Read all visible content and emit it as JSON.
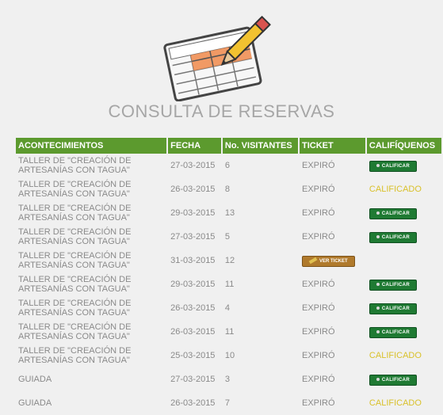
{
  "header": {
    "title": "CONSULTA DE RESERVAS",
    "logo_icon": "spreadsheet-with-pencil-icon"
  },
  "table": {
    "columns": [
      "ACONTECIMIENTOS",
      "FECHA",
      "No. VISITANTES",
      "TICKET",
      "CALIFÍQUENOS"
    ],
    "rows": [
      {
        "event": "TALLER DE \"CREACIÓN DE ARTESANÍAS CON TAGUA\"",
        "date": "27-03-2015",
        "visitors": "6",
        "ticket": "EXPIRÓ",
        "rating": "button",
        "rating_label": "CALIFICAR"
      },
      {
        "event": "TALLER DE \"CREACIÓN DE ARTESANÍAS CON TAGUA\"",
        "date": "26-03-2015",
        "visitors": "8",
        "ticket": "EXPIRÓ",
        "rating": "text",
        "rating_label": "CALIFICADO"
      },
      {
        "event": "TALLER DE \"CREACIÓN DE ARTESANÍAS CON TAGUA\"",
        "date": "29-03-2015",
        "visitors": "13",
        "ticket": "EXPIRÓ",
        "rating": "button",
        "rating_label": "CALIFICAR"
      },
      {
        "event": "TALLER DE \"CREACIÓN DE ARTESANÍAS CON TAGUA\"",
        "date": "27-03-2015",
        "visitors": "5",
        "ticket": "EXPIRÓ",
        "rating": "button",
        "rating_label": "CALIFICAR"
      },
      {
        "event": "TALLER DE \"CREACIÓN DE ARTESANÍAS CON TAGUA\"",
        "date": "31-03-2015",
        "visitors": "12",
        "ticket": "VER TICKET",
        "ticket_type": "button",
        "rating": "none",
        "rating_label": ""
      },
      {
        "event": "TALLER DE \"CREACIÓN DE ARTESANÍAS CON TAGUA\"",
        "date": "29-03-2015",
        "visitors": "11",
        "ticket": "EXPIRÓ",
        "rating": "button",
        "rating_label": "CALIFICAR"
      },
      {
        "event": "TALLER DE \"CREACIÓN DE ARTESANÍAS CON TAGUA\"",
        "date": "26-03-2015",
        "visitors": "4",
        "ticket": "EXPIRÓ",
        "rating": "button",
        "rating_label": "CALIFICAR"
      },
      {
        "event": "TALLER DE \"CREACIÓN DE ARTESANÍAS CON TAGUA\"",
        "date": "26-03-2015",
        "visitors": "11",
        "ticket": "EXPIRÓ",
        "rating": "button",
        "rating_label": "CALIFICAR"
      },
      {
        "event": "TALLER DE \"CREACIÓN DE ARTESANÍAS CON TAGUA\"",
        "date": "25-03-2015",
        "visitors": "10",
        "ticket": "EXPIRÓ",
        "rating": "text",
        "rating_label": "CALIFICADO"
      },
      {
        "event": "GUIADA",
        "date": "27-03-2015",
        "visitors": "3",
        "ticket": "EXPIRÓ",
        "rating": "button",
        "rating_label": "CALIFICAR"
      },
      {
        "event": "GUIADA",
        "date": "26-03-2015",
        "visitors": "7",
        "ticket": "EXPIRÓ",
        "rating": "text",
        "rating_label": "CALIFICADO"
      }
    ]
  },
  "colors": {
    "header_green": "#5c9a2e",
    "button_green": "#1f7a33",
    "calificado_yellow": "#d9c12a",
    "ticket_brown": "#b07a2c",
    "text_gray": "#8a8a8a",
    "title_gray": "#a6a6a6"
  }
}
